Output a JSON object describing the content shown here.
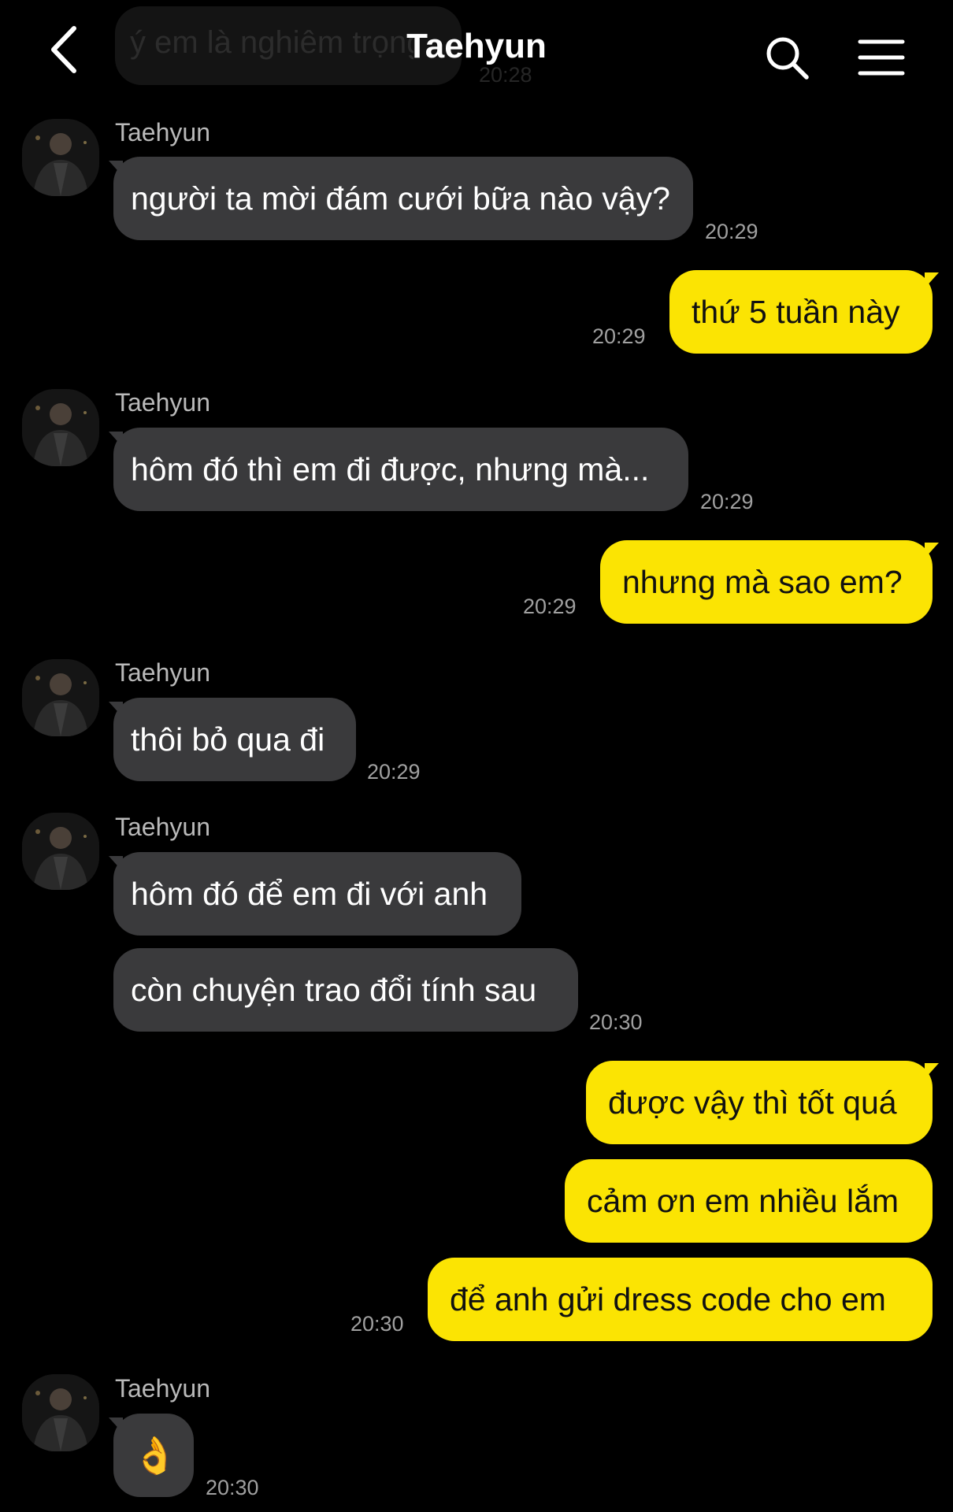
{
  "header": {
    "title": "Taehyun",
    "faded_prev_message": "ý em là nghiêm trọng",
    "faded_prev_time": "20:28"
  },
  "colors": {
    "background": "#000000",
    "incoming_bubble": "#3a3a3c",
    "outgoing_bubble": "#fbe403",
    "timestamp": "#a0a0a0"
  },
  "messages": {
    "m1": {
      "sender": "Taehyun",
      "text": "người ta mời đám cưới bữa nào vậy?",
      "time": "20:29"
    },
    "m2": {
      "text": "thứ 5 tuần này",
      "time": "20:29"
    },
    "m3": {
      "sender": "Taehyun",
      "text": "hôm đó thì em đi được, nhưng mà...",
      "time": "20:29"
    },
    "m4": {
      "text": "nhưng mà sao em?",
      "time": "20:29"
    },
    "m5": {
      "sender": "Taehyun",
      "text": "thôi bỏ qua đi",
      "time": "20:29"
    },
    "m6": {
      "sender": "Taehyun",
      "text": "hôm đó để em đi với anh"
    },
    "m7": {
      "text": "còn chuyện trao đổi tính sau",
      "time": "20:30"
    },
    "m8": {
      "text": "được vậy thì tốt quá"
    },
    "m9": {
      "text": "cảm ơn em nhiều lắm"
    },
    "m10": {
      "text": "để anh gửi dress code cho em",
      "time": "20:30"
    },
    "m11": {
      "sender": "Taehyun",
      "text": "👌",
      "time": "20:30"
    }
  },
  "icons": {
    "back": "chevron-left-icon",
    "search": "search-icon",
    "menu": "hamburger-menu-icon"
  }
}
